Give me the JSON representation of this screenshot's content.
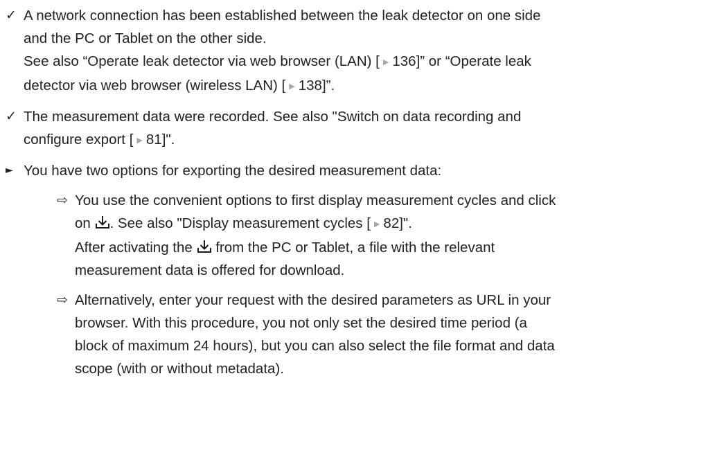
{
  "items": [
    {
      "bullet_icon": "check-icon",
      "line1": "A network connection has been established between the leak detector on one side",
      "line2": "and the PC or Tablet on the other side.",
      "line3_a": "See also “Operate leak detector via web browser (LAN) [",
      "line3_ref": "136",
      "line3_b": "]” or “Operate leak",
      "line4_a": "detector via web browser (wireless LAN) [",
      "line4_ref": "138",
      "line4_b": "]”."
    },
    {
      "bullet_icon": "check-icon",
      "line1": "The measurement data were recorded. See also \"Switch on data recording and",
      "line2_a": "configure export [",
      "line2_ref": "81",
      "line2_b": "]\"."
    },
    {
      "bullet_icon": "triangle-right-icon",
      "line1": "You have two options for exporting the desired measurement data:"
    }
  ],
  "options": [
    {
      "bullet_icon": "arrow-right-icon",
      "line1": "You use the convenient options to first display measurement cycles and click",
      "line2_a": "on",
      "line2_b": ". See also \"Display measurement cycles [",
      "line2_ref": "82",
      "line2_c": "]\".",
      "line3_a": "After activating the",
      "line3_b": "from the PC or Tablet, a file with the relevant",
      "line4": "measurement data is offered for download."
    },
    {
      "bullet_icon": "arrow-right-icon",
      "line1": "Alternatively, enter your request with the desired parameters as URL in your",
      "line2": "browser. With this procedure, you not only set the desired time period (a",
      "line3": "block of maximum 24 hours), but you can also select the file format and data",
      "line4": "scope (with or without metadata)."
    }
  ],
  "icons": {
    "download": "download-icon",
    "reference": "reference-arrow-icon"
  },
  "colors": {
    "text": "#222222",
    "reference_arrow": "#a8a8a8",
    "icon": "#1a1a1a"
  }
}
